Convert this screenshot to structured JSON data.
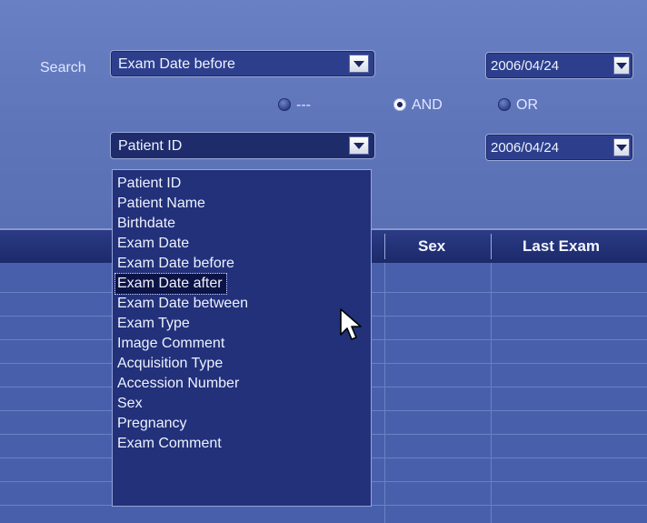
{
  "search": {
    "label": "Search",
    "field1": "Exam Date before",
    "field2": "Patient ID",
    "date1": "2006/04/24",
    "date2": "2006/04/24"
  },
  "logic": {
    "none_label": "---",
    "and_label": "AND",
    "or_label": "OR",
    "selected": "AND"
  },
  "dropdown": {
    "items": [
      "Patient ID",
      "Patient Name",
      "Birthdate",
      "Exam Date",
      "Exam Date before",
      "Exam Date after",
      "Exam Date between",
      "Exam Type",
      "Image Comment",
      "Acquisition Type",
      "Accession Number",
      "Sex",
      "Pregnancy",
      "Exam Comment"
    ],
    "highlighted": "Exam Date after"
  },
  "table": {
    "columns": [
      "Sex",
      "Last Exam"
    ]
  },
  "icons": {
    "dropdown_arrow": "chevron-down-icon",
    "cursor": "pointer-arrow-icon"
  },
  "colors": {
    "background": "#5a6fb0",
    "combo_bg": "#2d3f8c",
    "highlight": "#0c1445"
  }
}
